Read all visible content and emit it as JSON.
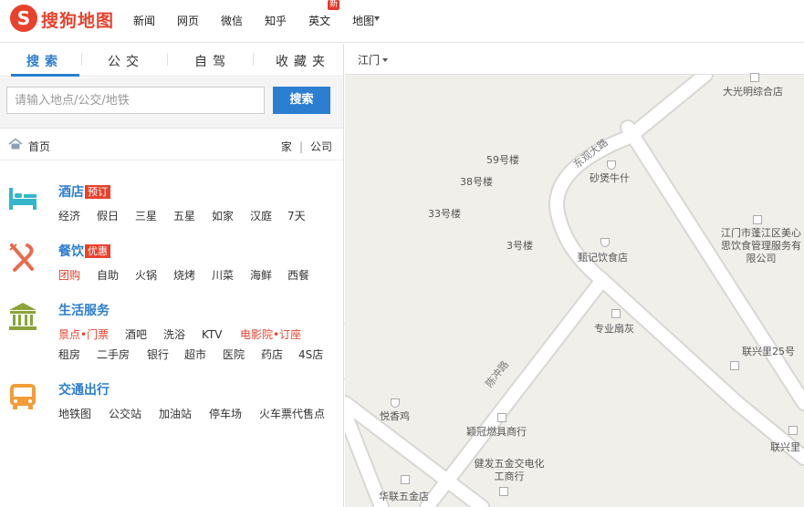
{
  "brand": {
    "logo_letter": "S",
    "name": "搜狗地图",
    "color": "#e8412c"
  },
  "nav": {
    "items": [
      {
        "label": "新闻"
      },
      {
        "label": "网页"
      },
      {
        "label": "微信"
      },
      {
        "label": "知乎"
      },
      {
        "label": "英文",
        "badge": "新"
      },
      {
        "label": "地图"
      }
    ]
  },
  "sidebar": {
    "tabs": [
      "搜索",
      "公交",
      "自驾",
      "收藏夹"
    ],
    "active_tab": "搜索",
    "search": {
      "placeholder": "请输入地点/公交/地铁",
      "value": "",
      "button_label": "搜索"
    },
    "crumb": {
      "home": "首页",
      "home_link": "家",
      "separator": "|",
      "company_link": "公司"
    },
    "categories": [
      {
        "title": "酒店",
        "tag": "预订",
        "icon": "bed-icon",
        "rows": [
          [
            "经济",
            "假日",
            "三星",
            "五星",
            "如家",
            "汉庭",
            "7天"
          ]
        ]
      },
      {
        "title": "餐饮",
        "tag": "优惠",
        "icon": "utensils-icon",
        "rows": [
          [
            "团购",
            "自助",
            "火锅",
            "烧烤",
            "川菜",
            "海鲜",
            "西餐"
          ]
        ]
      },
      {
        "title": "生活服务",
        "tag": "",
        "icon": "building-icon",
        "rows": [
          [
            "景点•门票",
            "酒吧",
            "洗浴",
            "KTV",
            "电影院•订座"
          ],
          [
            "租房",
            "二手房",
            "银行",
            "超市",
            "医院",
            "药店",
            "4S店"
          ]
        ]
      },
      {
        "title": "交通出行",
        "tag": "",
        "icon": "bus-icon",
        "rows": [
          [
            "地铁图",
            "公交站",
            "加油站",
            "停车场",
            "火车票代售点"
          ]
        ]
      }
    ],
    "highlight_links": [
      "团购",
      "景点•门票",
      "电影院•订座"
    ]
  },
  "map": {
    "city": "江门",
    "colors": {
      "background": "#f1efea",
      "road": "#ffffff",
      "road_edge": "#dcdad5"
    },
    "roads": [
      "东观大路",
      "陈冲路"
    ],
    "pois": [
      "大光明综合店",
      "59号楼",
      "38号楼",
      "33号楼",
      "3号楼",
      "砂煲牛什",
      "江门市蓬江区美心思饮食管理服务有限公司",
      "甄记饮食店",
      "专业扇灰",
      "联兴里25号",
      "悦香鸡",
      "颖冠燃具商行",
      "健发五金交电化工商行",
      "华联五金店",
      "联兴里"
    ]
  }
}
